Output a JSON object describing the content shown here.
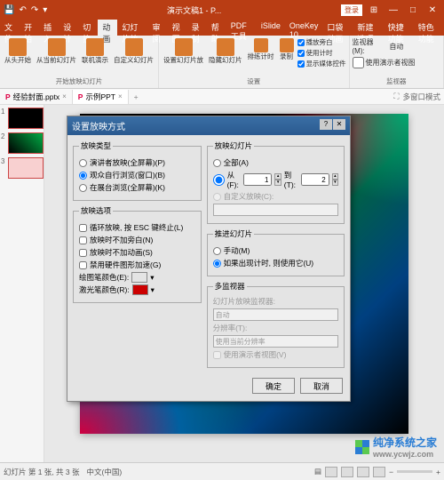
{
  "titlebar": {
    "doc_title": "演示文稿1 - P...",
    "login": "登录"
  },
  "menus": [
    "文件",
    "开始",
    "插入",
    "设计",
    "切换",
    "动画",
    "幻灯片放",
    "审阅",
    "视图",
    "录制",
    "帮助",
    "PDF工具",
    "iSlide",
    "OneKey 10",
    "口袋动画",
    "新建选项",
    "快捷功能",
    "特色功能"
  ],
  "active_menu_index": 5,
  "ribbon": {
    "g1": {
      "btns": [
        "从头开始",
        "从当前幻灯片",
        "联机演示",
        "自定义幻灯片"
      ],
      "title": "开始放映幻灯片"
    },
    "g2": {
      "btns": [
        "设置幻灯片放",
        "隐藏幻灯片",
        "排练计时",
        "录制"
      ],
      "chk": [
        "播放旁白",
        "使用计时",
        "显示媒体控件"
      ],
      "title": "设置"
    },
    "g3": {
      "label": "监视器(M):",
      "value": "自动",
      "btn": "使用演示者视图",
      "title": "监视器"
    }
  },
  "tabs": [
    {
      "icon": "P",
      "label": "经验封面.pptx"
    },
    {
      "icon": "P",
      "label": "示例PPT"
    }
  ],
  "active_tab": 1,
  "toolbar_right": [
    "多窗口模式"
  ],
  "thumbs": [
    "1",
    "2",
    "3"
  ],
  "dialog": {
    "title": "设置放映方式",
    "type": {
      "legend": "放映类型",
      "opts": [
        "演讲者放映(全屏幕)(P)",
        "观众自行浏览(窗口)(B)",
        "在展台浏览(全屏幕)(K)"
      ],
      "selected": 1
    },
    "options": {
      "legend": "放映选项",
      "chk": [
        "循环放映, 按 ESC 键终止(L)",
        "放映时不加旁白(N)",
        "放映时不加动画(S)",
        "禁用硬件图形加速(G)"
      ],
      "pen_label": "绘图笔颜色(E):",
      "laser_label": "激光笔颜色(R):"
    },
    "slides": {
      "legend": "放映幻灯片",
      "all": "全部(A)",
      "from": "从(F):",
      "from_v": "1",
      "to": "到(T):",
      "to_v": "2",
      "custom": "自定义放映(C):"
    },
    "advance": {
      "legend": "推进幻灯片",
      "opts": [
        "手动(M)",
        "如果出现计时, 则使用它(U)"
      ],
      "selected": 1
    },
    "multi": {
      "legend": "多监视器",
      "mon_label": "幻灯片放映监视器:",
      "mon_val": "自动",
      "res_label": "分辨率(T):",
      "res_val": "使用当前分辨率",
      "pres": "使用演示者视图(V)"
    },
    "ok": "确定",
    "cancel": "取消"
  },
  "status": {
    "slide": "幻灯片 第 1 张, 共 3 张",
    "lang": "中文(中国)"
  },
  "watermark": {
    "text": "纯净系统之家",
    "url": "www.ycwjz.com"
  }
}
